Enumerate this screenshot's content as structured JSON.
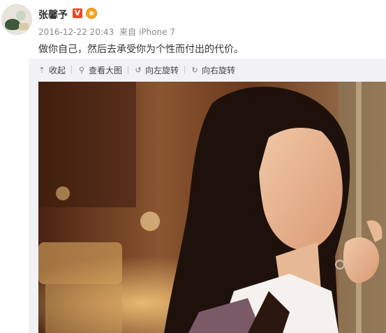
{
  "user": {
    "name": "张馨予",
    "verified_mark": "V",
    "badge_icon": "vip-crown-icon"
  },
  "post": {
    "timestamp": "2016-12-22 20:43",
    "source_prefix": "来自",
    "source": "iPhone 7",
    "text": "做你自己，然后去承受你为个性而付出的代价。"
  },
  "media_toolbar": {
    "collapse": {
      "icon": "arrow-up-icon",
      "label": "收起"
    },
    "view_large": {
      "icon": "magnifier-icon",
      "label": "查看大图"
    },
    "rotate_left": {
      "icon": "rotate-left-icon",
      "label": "向左旋转"
    },
    "rotate_right": {
      "icon": "rotate-right-icon",
      "label": "向右旋转"
    }
  },
  "colors": {
    "vip_red": "#e8492a",
    "badge_gold": "#f5a623",
    "meta_gray": "#888888",
    "toolbar_bg": "#f2f2f5"
  }
}
